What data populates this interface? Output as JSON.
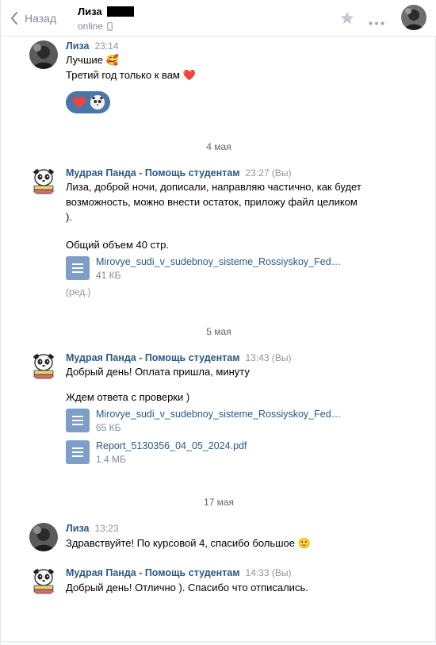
{
  "header": {
    "back_label": "Назад",
    "peer_name": "Лиза",
    "peer_status": "online"
  },
  "colors": {
    "link_blue": "#2a5885",
    "accent": "#4a76a8",
    "file_icon": "#7d9fc7",
    "muted": "#828a99"
  },
  "icons": {
    "back": "chevron-left-icon",
    "mobile": "mobile-phone-icon",
    "favorite": "star-icon",
    "more": "more-dots-icon",
    "document": "document-icon",
    "heart": "heart-icon",
    "panda": "panda-sticker-icon"
  },
  "messages": {
    "m1": {
      "author": "Лиза",
      "time": "23:14",
      "line1": "Лучшие 🥰",
      "line2": "Третий год только к вам ❤️"
    },
    "sep1": "4 мая",
    "m2": {
      "author": "Мудрая Панда - Помощь студентам",
      "time": "23:27 (Вы)",
      "line1": "Лиза, доброй ночи, дописали, направляю частично, как будет",
      "line2": "возможность, можно внести остаток, приложу файл целиком",
      "line3": ").",
      "line4": "Общий объем 40 стр.",
      "file_name": "Mirovye_sudi_v_sudebnoy_sisteme_Rossiyskoy_Federatsii.docx",
      "file_size": "41 КБ",
      "edited": "(ред.)"
    },
    "sep2": "5 мая",
    "m3": {
      "author": "Мудрая Панда - Помощь студентам",
      "time": "13:43 (Вы)",
      "line1": "Добрый день! Оплата пришла, минуту",
      "line2": "Ждем ответа с проверки )",
      "file1_name": "Mirovye_sudi_v_sudebnoy_sisteme_Rossiyskoy_Federatsii.docx",
      "file1_size": "65 КБ",
      "file2_name": "Report_5130356_04_05_2024.pdf",
      "file2_size": "1.4 МБ"
    },
    "sep3": "17 мая",
    "m4": {
      "author": "Лиза",
      "time": "13:23",
      "line1": "Здравствуйте! По курсовой 4, спасибо большое 🙂"
    },
    "m5": {
      "author": "Мудрая Панда - Помощь студентам",
      "time": "14:33 (Вы)",
      "line1": "Добрый день! Отлично ). Спасибо что отписались."
    }
  }
}
